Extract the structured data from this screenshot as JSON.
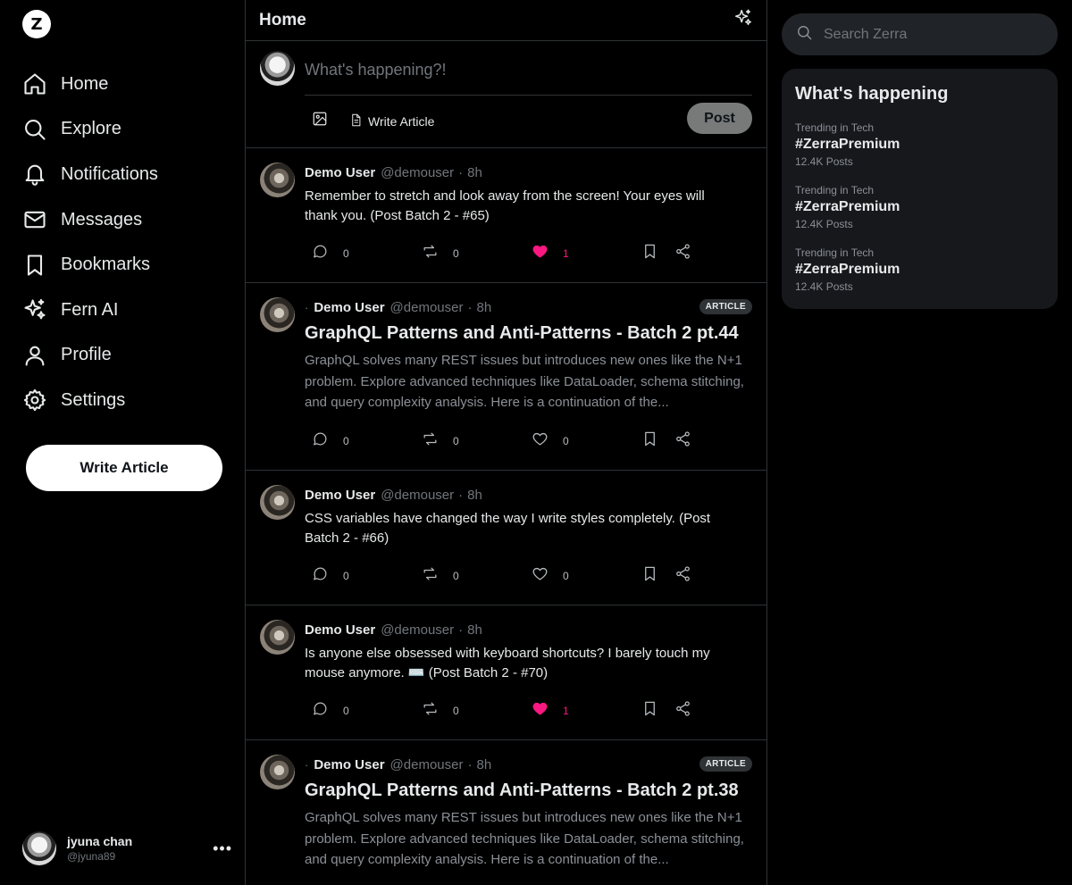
{
  "app": {
    "logo_letter": "Z"
  },
  "sidebar": {
    "items": [
      {
        "label": "Home",
        "icon": "home-icon"
      },
      {
        "label": "Explore",
        "icon": "search-icon"
      },
      {
        "label": "Notifications",
        "icon": "bell-icon"
      },
      {
        "label": "Messages",
        "icon": "mail-icon"
      },
      {
        "label": "Bookmarks",
        "icon": "bookmark-icon"
      },
      {
        "label": "Fern AI",
        "icon": "sparkles-icon"
      },
      {
        "label": "Profile",
        "icon": "user-icon"
      },
      {
        "label": "Settings",
        "icon": "gear-icon"
      }
    ],
    "write_article_label": "Write Article",
    "user": {
      "name": "jyuna chan",
      "handle": "@jyuna89",
      "more": "•••"
    }
  },
  "header": {
    "title": "Home"
  },
  "composer": {
    "placeholder": "What's happening?!",
    "write_article_label": "Write Article",
    "post_label": "Post"
  },
  "posts": [
    {
      "type": "post",
      "name": "Demo User",
      "handle": "@demouser",
      "sep": "·",
      "time": "8h",
      "body": "Remember to stretch and look away from the screen! Your eyes will thank you. (Post Batch 2 - #65)",
      "replies": "0",
      "reposts": "0",
      "likes": "1",
      "liked": true
    },
    {
      "type": "article",
      "prefix": "·",
      "name": "Demo User",
      "handle": "@demouser",
      "sep": "·",
      "time": "8h",
      "badge": "ARTICLE",
      "title": "GraphQL Patterns and Anti-Patterns - Batch 2 pt.44",
      "excerpt": "GraphQL solves many REST issues but introduces new ones like the N+1 problem. Explore advanced techniques like DataLoader, schema stitching, and query complexity analysis. Here is a continuation of the...",
      "replies": "0",
      "reposts": "0",
      "likes": "0",
      "liked": false
    },
    {
      "type": "post",
      "name": "Demo User",
      "handle": "@demouser",
      "sep": "·",
      "time": "8h",
      "body": "CSS variables have changed the way I write styles completely. (Post Batch 2 - #66)",
      "replies": "0",
      "reposts": "0",
      "likes": "0",
      "liked": false
    },
    {
      "type": "post",
      "name": "Demo User",
      "handle": "@demouser",
      "sep": "·",
      "time": "8h",
      "body": "Is anyone else obsessed with keyboard shortcuts? I barely touch my mouse anymore. ⌨️ (Post Batch 2 - #70)",
      "replies": "0",
      "reposts": "0",
      "likes": "1",
      "liked": true
    },
    {
      "type": "article",
      "prefix": "·",
      "name": "Demo User",
      "handle": "@demouser",
      "sep": "·",
      "time": "8h",
      "badge": "ARTICLE",
      "title": "GraphQL Patterns and Anti-Patterns - Batch 2 pt.38",
      "excerpt": "GraphQL solves many REST issues but introduces new ones like the N+1 problem. Explore advanced techniques like DataLoader, schema stitching, and query complexity analysis. Here is a continuation of the...",
      "replies": "0",
      "reposts": "0",
      "likes": "0",
      "liked": false
    }
  ],
  "search": {
    "placeholder": "Search Zerra"
  },
  "trends": {
    "title": "What's happening",
    "items": [
      {
        "category": "Trending in Tech",
        "tag": "#ZerraPremium",
        "count": "12.4K Posts"
      },
      {
        "category": "Trending in Tech",
        "tag": "#ZerraPremium",
        "count": "12.4K Posts"
      },
      {
        "category": "Trending in Tech",
        "tag": "#ZerraPremium",
        "count": "12.4K Posts"
      }
    ]
  },
  "colors": {
    "accent_like": "#f91880",
    "background": "#000000",
    "border": "#2f3336"
  }
}
